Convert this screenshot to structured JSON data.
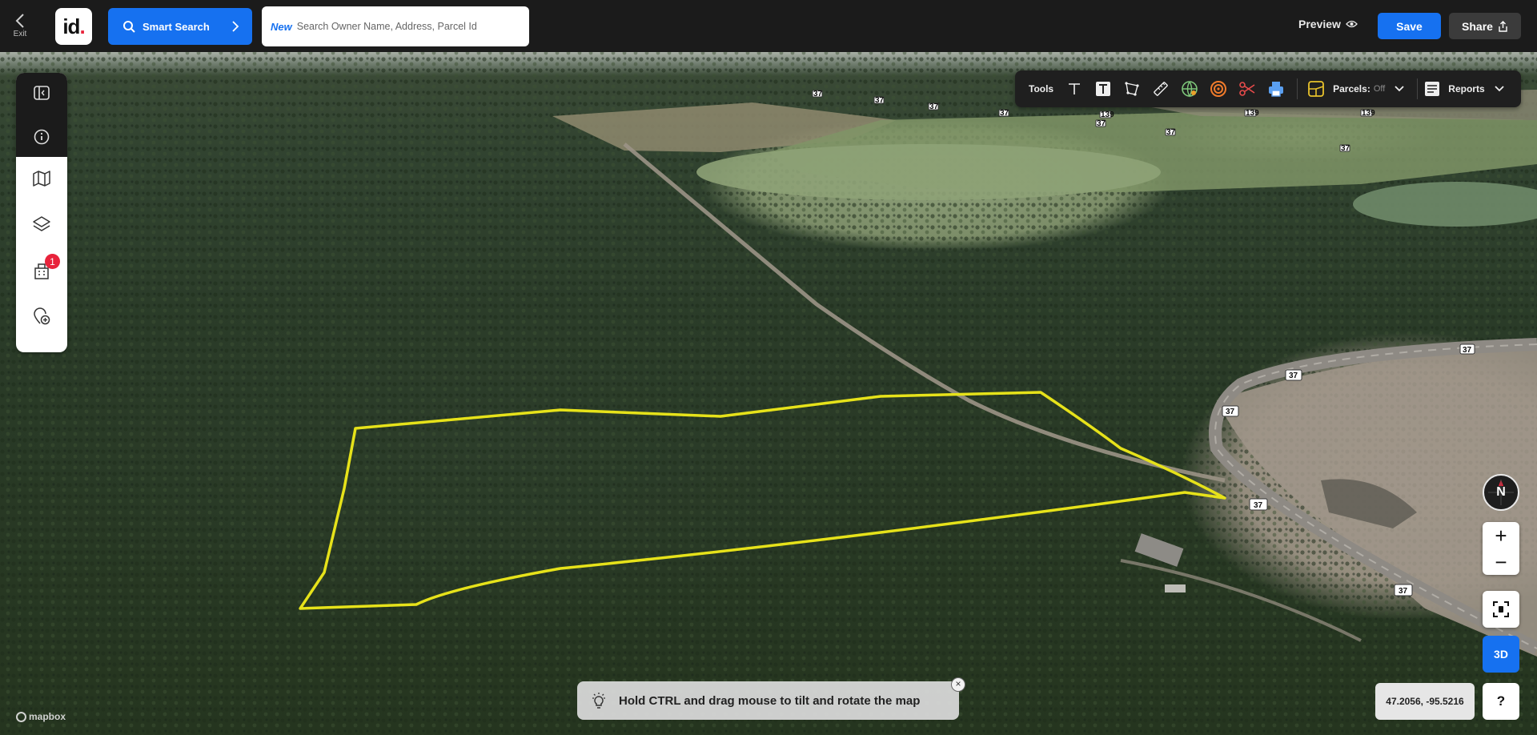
{
  "header": {
    "exit_label": "Exit",
    "logo_text": "id",
    "logo_dot": ".",
    "smart_search_label": "Smart Search",
    "search_new_tag": "New",
    "search_placeholder": "Search Owner Name, Address, Parcel Id",
    "preview_label": "Preview",
    "save_label": "Save",
    "share_label": "Share"
  },
  "sidebar": {
    "items": [
      {
        "name": "collapse-panel",
        "icon": "panel-toggle-icon"
      },
      {
        "name": "info",
        "icon": "info-icon"
      },
      {
        "name": "map",
        "icon": "map-icon"
      },
      {
        "name": "layers",
        "icon": "layers-icon"
      },
      {
        "name": "buildings",
        "icon": "buildings-icon",
        "badge": "1"
      },
      {
        "name": "add-location",
        "icon": "location-plus-icon"
      }
    ]
  },
  "tools": {
    "label": "Tools",
    "items": [
      "text-tool-icon",
      "text-box-tool-icon",
      "polygon-tool-icon",
      "ruler-icon",
      "globe-icon",
      "radius-icon",
      "scissors-icon",
      "printer-icon"
    ],
    "parcels_label": "Parcels:",
    "parcels_state": "Off",
    "reports_label": "Reports"
  },
  "map": {
    "attribution": "mapbox",
    "route_shields": [
      "37",
      "37",
      "37",
      "37",
      "37",
      "37",
      "37",
      "37",
      "37",
      "37",
      "139",
      "139",
      "139",
      "37"
    ],
    "parcel_outline_color": "#e6e21a"
  },
  "controls": {
    "compass_label": "N",
    "zoom_in": "+",
    "zoom_out": "−",
    "three_d_label": "3D",
    "coordinates": "47.2056, -95.5216",
    "help_label": "?"
  },
  "hint": {
    "text": "Hold CTRL and drag mouse to tilt and rotate the map",
    "close": "×"
  },
  "colors": {
    "accent": "#1671f0",
    "topbar": "#1b1b1b",
    "badge": "#e8233b",
    "parcel": "#e6e21a"
  }
}
